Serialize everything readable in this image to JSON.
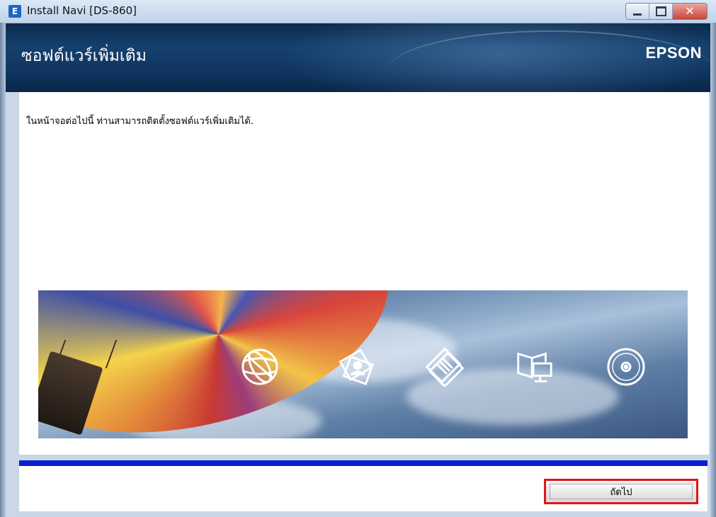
{
  "window": {
    "title": "Install Navi [DS-860]",
    "app_icon_letter": "E"
  },
  "header": {
    "title": "ซอฟต์แวร์เพิ่มเติม",
    "brand": "EPSON"
  },
  "main": {
    "intro_text": "ในหน้าจอต่อไปนี้ ท่านสามารถติดตั้งซอฟต์แวร์เพิ่มเติมได้."
  },
  "banner": {
    "icons": [
      "globe-icon",
      "photo-icon",
      "documents-icon",
      "book-monitor-icon",
      "disc-icon"
    ]
  },
  "footer": {
    "next_label": "ถัดไป"
  },
  "colors": {
    "header_bg": "#0f3560",
    "accent_bar": "#0b1fd0",
    "highlight_border": "#e0161b"
  }
}
